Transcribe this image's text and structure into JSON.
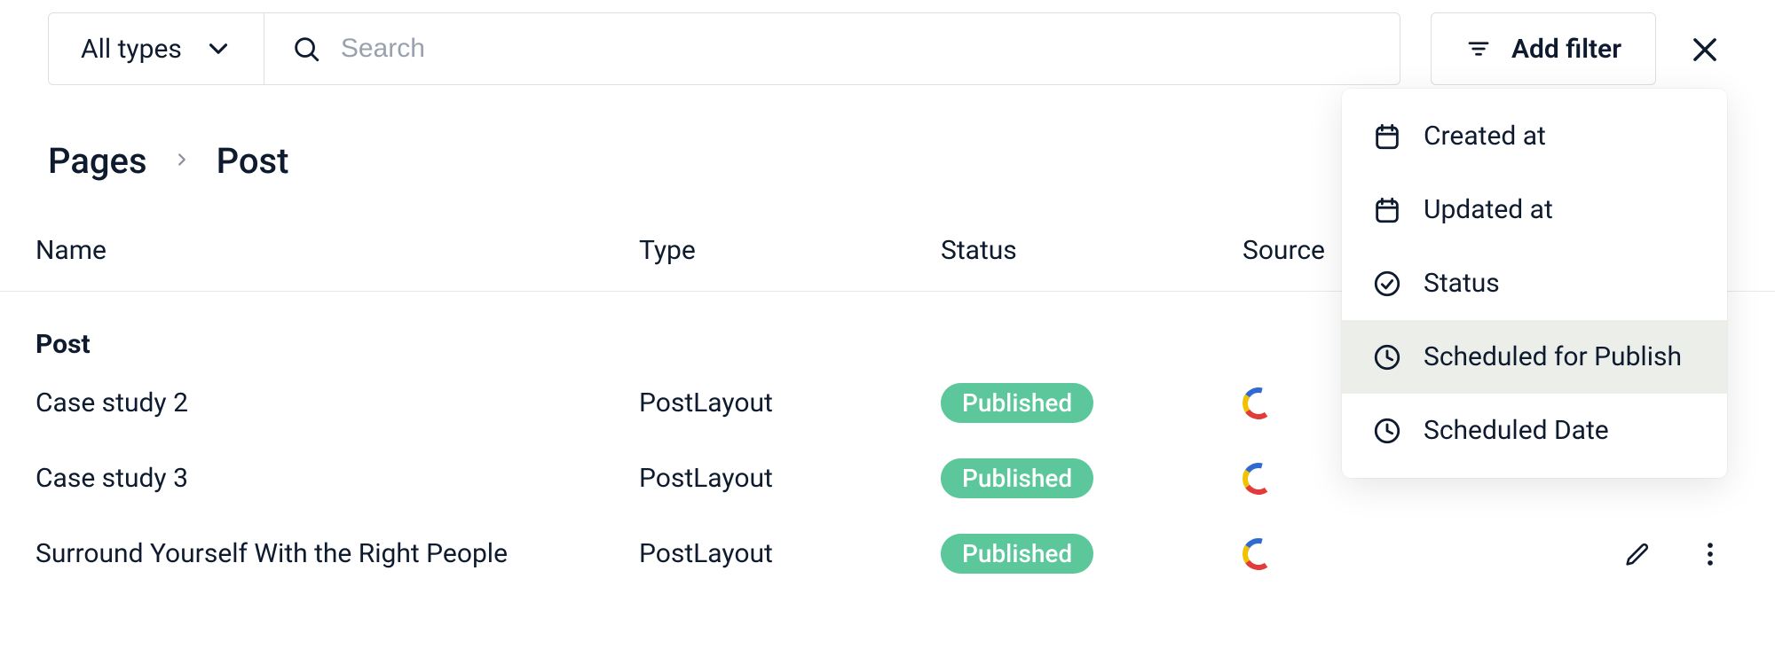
{
  "toolbar": {
    "type_select_label": "All types",
    "search_placeholder": "Search",
    "add_filter_label": "Add filter"
  },
  "breadcrumb": {
    "root": "Pages",
    "current": "Post"
  },
  "columns": {
    "name": "Name",
    "type": "Type",
    "status": "Status",
    "source": "Source"
  },
  "group_label": "Post",
  "rows": [
    {
      "name": "Case study 2",
      "type": "PostLayout",
      "status": "Published",
      "source": "contentful"
    },
    {
      "name": "Case study 3",
      "type": "PostLayout",
      "status": "Published",
      "source": "contentful"
    },
    {
      "name": "Surround Yourself With the Right People",
      "type": "PostLayout",
      "status": "Published",
      "source": "contentful"
    }
  ],
  "status_color": "#5bc79b",
  "filter_menu": {
    "items": [
      {
        "icon": "calendar-icon",
        "label": "Created at"
      },
      {
        "icon": "calendar-icon",
        "label": "Updated at"
      },
      {
        "icon": "check-circle-icon",
        "label": "Status"
      },
      {
        "icon": "clock-icon",
        "label": "Scheduled for Publish",
        "hovered": true
      },
      {
        "icon": "clock-icon",
        "label": "Scheduled Date"
      }
    ]
  }
}
